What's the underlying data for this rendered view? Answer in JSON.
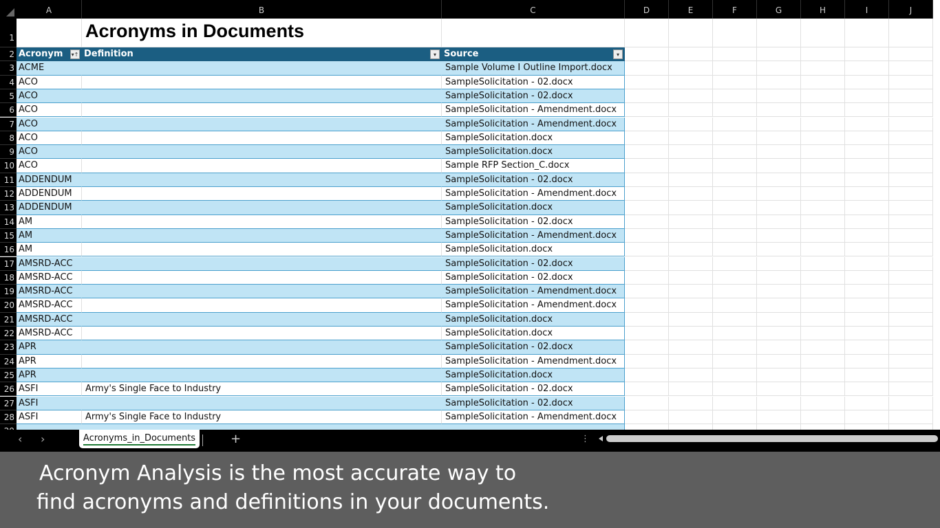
{
  "columns": [
    "A",
    "B",
    "C",
    "D",
    "E",
    "F",
    "G",
    "H",
    "I",
    "J"
  ],
  "sheet_title": "Acronyms in Documents",
  "table_headers": [
    "Acronym",
    "Definition",
    "Source"
  ],
  "rows": [
    [
      "ACME",
      "",
      "Sample Volume I Outline Import.docx"
    ],
    [
      "ACO",
      "",
      "SampleSolicitation - 02.docx"
    ],
    [
      "ACO",
      "",
      "SampleSolicitation - 02.docx"
    ],
    [
      "ACO",
      "",
      "SampleSolicitation - Amendment.docx"
    ],
    [
      "ACO",
      "",
      "SampleSolicitation - Amendment.docx"
    ],
    [
      "ACO",
      "",
      "SampleSolicitation.docx"
    ],
    [
      "ACO",
      "",
      "SampleSolicitation.docx"
    ],
    [
      "ACO",
      "",
      "Sample RFP Section_C.docx"
    ],
    [
      "ADDENDUM",
      "",
      "SampleSolicitation - 02.docx"
    ],
    [
      "ADDENDUM",
      "",
      "SampleSolicitation - Amendment.docx"
    ],
    [
      "ADDENDUM",
      "",
      "SampleSolicitation.docx"
    ],
    [
      "AM",
      "",
      "SampleSolicitation - 02.docx"
    ],
    [
      "AM",
      "",
      "SampleSolicitation - Amendment.docx"
    ],
    [
      "AM",
      "",
      "SampleSolicitation.docx"
    ],
    [
      "AMSRD-ACC",
      "",
      "SampleSolicitation - 02.docx"
    ],
    [
      "AMSRD-ACC",
      "",
      "SampleSolicitation - 02.docx"
    ],
    [
      "AMSRD-ACC",
      "",
      "SampleSolicitation - Amendment.docx"
    ],
    [
      "AMSRD-ACC",
      "",
      "SampleSolicitation - Amendment.docx"
    ],
    [
      "AMSRD-ACC",
      "",
      "SampleSolicitation.docx"
    ],
    [
      "AMSRD-ACC",
      "",
      "SampleSolicitation.docx"
    ],
    [
      "APR",
      "",
      "SampleSolicitation - 02.docx"
    ],
    [
      "APR",
      "",
      "SampleSolicitation - Amendment.docx"
    ],
    [
      "APR",
      "",
      "SampleSolicitation.docx"
    ],
    [
      "ASFI",
      "Army's Single Face to Industry",
      "SampleSolicitation - 02.docx"
    ],
    [
      "ASFI",
      "",
      "SampleSolicitation - 02.docx"
    ],
    [
      "ASFI",
      "Army's Single Face to Industry",
      "SampleSolicitation - Amendment.docx"
    ]
  ],
  "sheet_tab": "Acronyms_in_Documents",
  "tabbar": {
    "prev": "‹",
    "next": "›",
    "add": "+",
    "more": "⋮"
  },
  "caption": {
    "line1": "Acronym Analysis is the most accurate way to",
    "line2": "find acronyms and definitions in your documents."
  },
  "colors": {
    "header": "#1b5e82",
    "band": "#c0e4f5",
    "caption_bg": "#5e5e5e"
  }
}
